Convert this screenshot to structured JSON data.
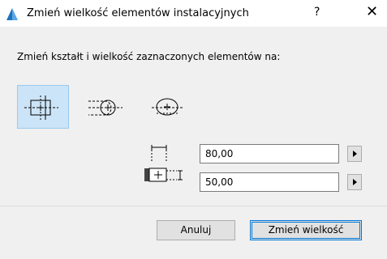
{
  "window": {
    "title": "Zmień wielkość elementów instalacyjnych",
    "help_label": "?",
    "close_label": "✕"
  },
  "instruction": "Zmień kształt i wielkość zaznaczonych elementów na:",
  "shapes": [
    {
      "name": "rectangular",
      "selected": true
    },
    {
      "name": "rect-to-round",
      "selected": false
    },
    {
      "name": "oval",
      "selected": false
    }
  ],
  "fields": {
    "width_value": "80,00",
    "height_value": "50,00"
  },
  "buttons": {
    "cancel_label": "Anuluj",
    "resize_label": "Zmień wielkość"
  },
  "colors": {
    "accent": "#0078d7",
    "selected_bg": "#cce4f7"
  }
}
